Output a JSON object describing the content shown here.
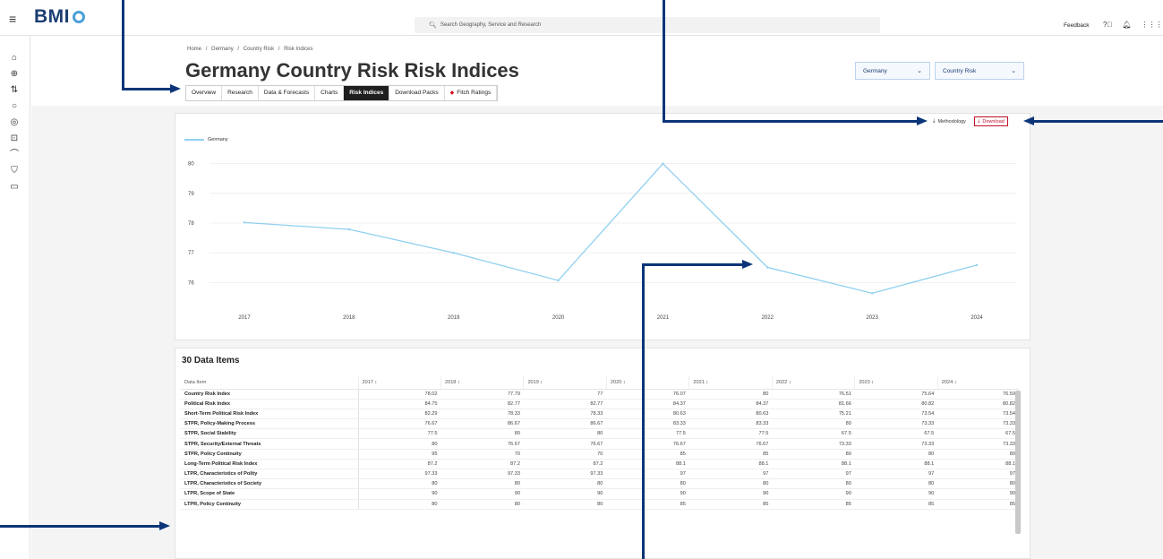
{
  "app": {
    "brand": "BMI"
  },
  "search": {
    "placeholder": "Search Geography, Service and Research"
  },
  "topnav": {
    "feedback": "Feedback"
  },
  "breadcrumb": [
    "Home",
    "/",
    "Germany",
    "/",
    "Country Risk",
    "/",
    "Risk Indices"
  ],
  "page": {
    "title": "Germany Country Risk Risk Indices"
  },
  "tabs": [
    {
      "label": "Overview"
    },
    {
      "label": "Research"
    },
    {
      "label": "Data & Forecasts"
    },
    {
      "label": "Charts"
    },
    {
      "label": "Risk Indices",
      "active": true
    },
    {
      "label": "Download Packs"
    },
    {
      "label": "Fitch Ratings"
    }
  ],
  "selectors": {
    "country": "Germany",
    "service": "Country Risk"
  },
  "actions": {
    "methodology": "Methodology",
    "download": "Download"
  },
  "colors": {
    "accent": "#1a3e72",
    "line": "#8fd0f0",
    "download": "#c0102a",
    "arrow": "#0b3578"
  },
  "chart_data": {
    "type": "line",
    "categories": [
      "2017",
      "2018",
      "2019",
      "2020",
      "2021",
      "2022",
      "2023",
      "2024"
    ],
    "series": [
      {
        "name": "Germany",
        "values": [
          78.02,
          77.79,
          77,
          76.07,
          80,
          76.51,
          75.64,
          76.59
        ]
      }
    ],
    "ylim": [
      75.5,
      80.2
    ],
    "yticks": [
      "80",
      "79",
      "78",
      "77",
      "76"
    ],
    "legend": "top-left",
    "grid": true
  },
  "table": {
    "title": "30 Data Items",
    "header": [
      "Data Item",
      "2017 ↕",
      "2018 ↕",
      "2019 ↕",
      "2020 ↕",
      "2021 ↕",
      "2022 ↕",
      "2023 ↕",
      "2024 ↕"
    ],
    "rows": [
      [
        "Country Risk Index",
        "78.02",
        "77.79",
        "77",
        "76.07",
        "80",
        "76.51",
        "75.64",
        "76.59"
      ],
      [
        "Political Risk Index",
        "84.75",
        "82.77",
        "82.77",
        "84.37",
        "84.37",
        "81.66",
        "80.82",
        "80.82"
      ],
      [
        "Short-Term Political Risk Index",
        "82.29",
        "78.33",
        "78.33",
        "80.63",
        "80.63",
        "75.21",
        "73.54",
        "73.54"
      ],
      [
        "STPR, Policy-Making Process",
        "76.67",
        "86.67",
        "86.67",
        "83.33",
        "83.33",
        "80",
        "73.33",
        "73.33"
      ],
      [
        "STPR, Social Stability",
        "77.5",
        "80",
        "80",
        "77.5",
        "77.5",
        "67.5",
        "67.5",
        "67.5"
      ],
      [
        "STPR, Security/External Threats",
        "80",
        "76.67",
        "76.67",
        "76.67",
        "76.67",
        "73.33",
        "73.33",
        "73.33"
      ],
      [
        "STPR, Policy Continuity",
        "95",
        "70",
        "70",
        "85",
        "85",
        "80",
        "80",
        "80"
      ],
      [
        "Long-Term Political Risk Index",
        "87.2",
        "87.2",
        "87.2",
        "88.1",
        "88.1",
        "88.1",
        "88.1",
        "88.1"
      ],
      [
        "LTPR, Characteristics of Polity",
        "97.33",
        "97.33",
        "97.33",
        "97",
        "97",
        "97",
        "97",
        "97"
      ],
      [
        "LTPR, Characteristics of Society",
        "80",
        "80",
        "80",
        "80",
        "80",
        "80",
        "80",
        "80"
      ],
      [
        "LTPR, Scope of State",
        "90",
        "90",
        "90",
        "90",
        "90",
        "90",
        "90",
        "90"
      ],
      [
        "LTPR, Policy Continuity",
        "80",
        "80",
        "80",
        "85",
        "85",
        "85",
        "85",
        "85"
      ]
    ]
  }
}
